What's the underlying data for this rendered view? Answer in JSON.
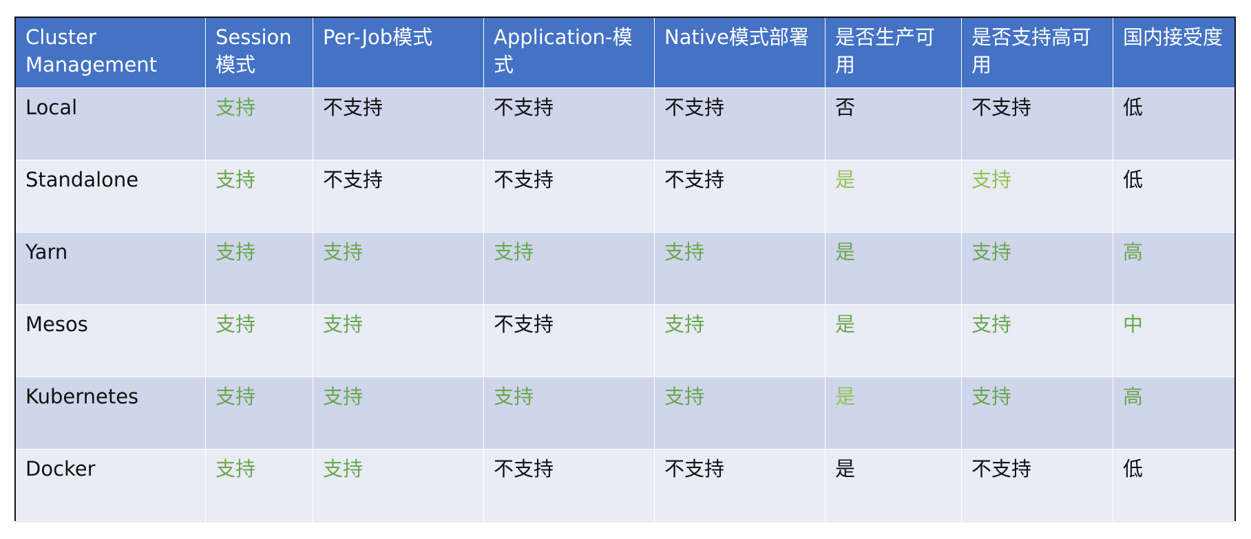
{
  "colors": {
    "header_bg": "#4472c4",
    "row_odd": "#cfd5ea",
    "row_even": "#e9ebf5",
    "support_green": "#6aa84f",
    "support_light_green": "#92c353"
  },
  "table": {
    "headers": [
      "Cluster Management",
      "Session模式",
      "Per-Job模式",
      "Application-模式",
      "Native模式部署",
      "是否生产可用",
      "是否支持高可用",
      "国内接受度"
    ],
    "rows": [
      [
        "Local",
        "支持",
        "不支持",
        "不支持",
        "不支持",
        "否",
        "不支持",
        "低"
      ],
      [
        "Standalone",
        "支持",
        "不支持",
        "不支持",
        "不支持",
        "是",
        "支持",
        "低"
      ],
      [
        "Yarn",
        "支持",
        "支持",
        "支持",
        "支持",
        "是",
        "支持",
        "高"
      ],
      [
        "Mesos",
        "支持",
        "支持",
        "不支持",
        "支持",
        "是",
        "支持",
        "中"
      ],
      [
        "Kubernetes",
        "支持",
        "支持",
        "支持",
        "支持",
        "是",
        "支持",
        "高"
      ],
      [
        "Docker",
        "支持",
        "支持",
        "不支持",
        "不支持",
        "是",
        "不支持",
        "低"
      ]
    ]
  }
}
